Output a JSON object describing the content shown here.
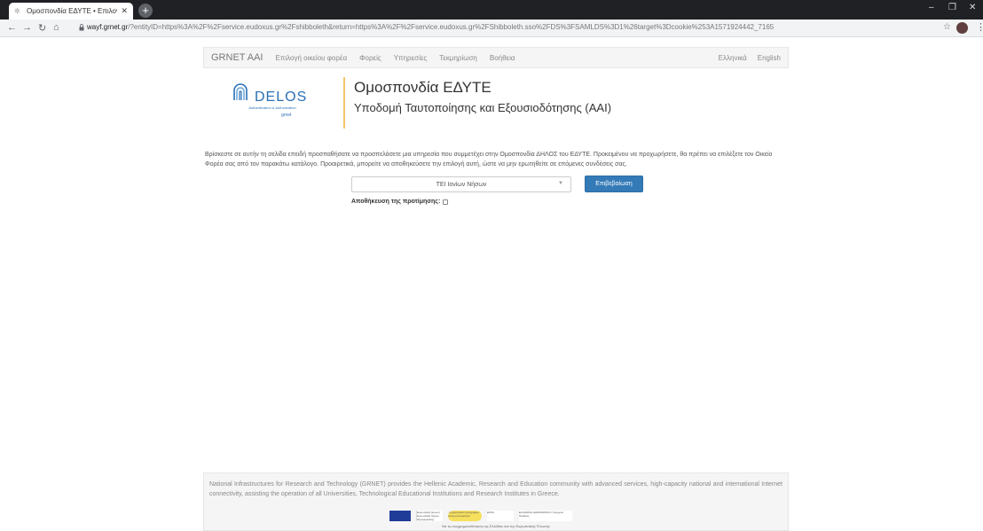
{
  "browser": {
    "tab_title": "Ομοσπονδία ΕΔΥΤΕ • Επιλογή οι",
    "tab_icon": "page-favicon",
    "url_host": "wayf.grnet.gr",
    "url_path": "/?entityID=https%3A%2F%2Fservice.eudoxus.gr%2Fshibboleth&return=https%3A%2F%2Fservice.eudoxus.gr%2FShibboleth.sso%2FDS%3FSAMLDS%3D1%26target%3Dcookie%253A1571924442_7165"
  },
  "navbar": {
    "brand": "GRNET AAI",
    "items": [
      "Επιλογή οικείου φορέα",
      "Φορείς",
      "Υπηρεσίες",
      "Τεκμηρίωση",
      "Βοήθεια"
    ],
    "languages": [
      "Ελληνικά",
      "English"
    ]
  },
  "header": {
    "logo_text": "DELOS",
    "logo_sub": "Authentication & Authorization",
    "logo_org": "grnet",
    "title": "Ομοσπονδία ΕΔΥΤΕ",
    "subtitle": "Υποδομή Ταυτοποίησης και Εξουσιοδότησης (AAI)"
  },
  "main": {
    "intro": "Βρίσκεστε σε αυτήν τη σελίδα επειδή προσπαθήσατε να προσπελάσετε μια υπηρεσία που συμμετέχει στην Ομοσπονδία ΔΗΛΟΣ του ΕΔΥΤΕ. Προκειμένου να προχωρήσετε, θα πρέπει να επιλέξετε τον Οικείο Φορέα σας από τον παρακάτω κατάλογο. Προαιρετικά, μπορείτε να αποθηκεύσετε την επιλογή αυτή, ώστε να μην ερωτηθείτε σε επόμενες συνδέσεις σας.",
    "select_value": "ΤΕΙ Ιονίων Νήσων",
    "confirm_label": "Επιβεβαίωση",
    "remember_label": "Αποθήκευση της προτίμησης:"
  },
  "footer": {
    "text": "National Infrastructures for Research and Technology (GRNET) provides the Hellenic Academic, Research and Education community with advanced services, high-capacity national and international Internet connectivity, assisting the operation of all Universities, Technological Educational Institutions and Research Institutes in Greece.",
    "caption": "Με τη συγχρηματοδότηση της Ελλάδας και της Ευρωπαϊκής Ένωσης",
    "logo_eu_text": "Ευρωπαϊκή Ένωση Ευρωπαϊκό Ταμείο Περιφερειακής Ανάπτυξης",
    "logo_growth": "επιχειρησιακό πρόγραμμα ανταγωνιστικότητα",
    "logo_espa": "ΕΣΠΑ",
    "logo_gov": "ΕΛΛΗΝΙΚΗ ΔΗΜΟΚΡΑΤΙΑ Υπουργείο Παιδείας"
  }
}
